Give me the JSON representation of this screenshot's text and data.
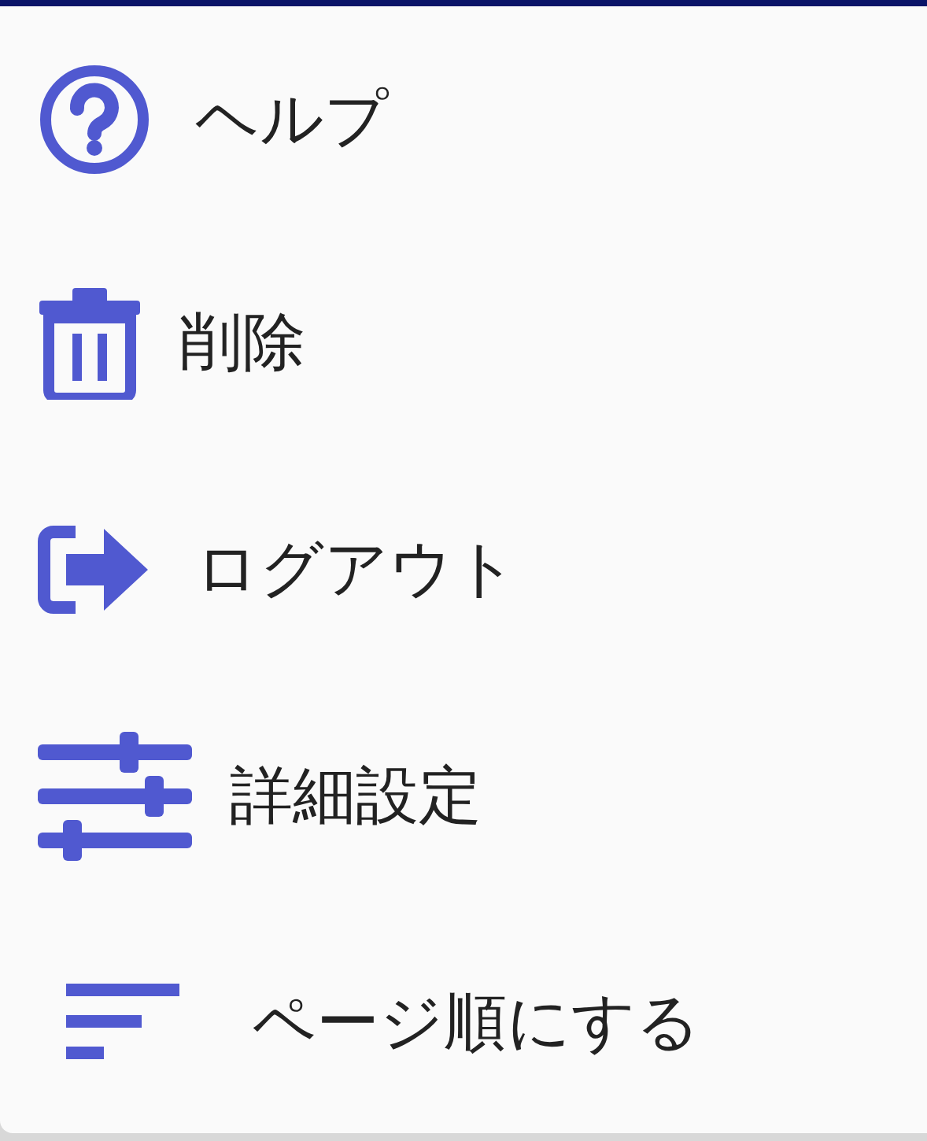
{
  "menu": {
    "items": [
      {
        "label": "ヘルプ"
      },
      {
        "label": "削除"
      },
      {
        "label": "ログアウト"
      },
      {
        "label": "詳細設定"
      },
      {
        "label": "ページ順にする"
      }
    ]
  }
}
